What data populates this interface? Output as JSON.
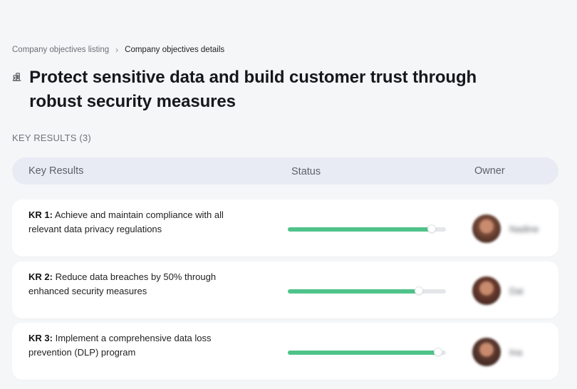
{
  "breadcrumb": {
    "parent": "Company objectives listing",
    "separator": "›",
    "current": "Company objectives details"
  },
  "objective": {
    "icon": "building-icon",
    "title": "Protect sensitive data and build customer trust through robust security measures"
  },
  "section": {
    "label": "KEY RESULTS (3)"
  },
  "table": {
    "headers": {
      "key_results": "Key Results",
      "status": "Status",
      "owner": "Owner"
    },
    "rows": [
      {
        "label": "KR 1:",
        "text": "Achieve and maintain compliance with all relevant data privacy regulations",
        "progress": 0.91,
        "owner": "Nadine",
        "avatar_color": "#7a4a38"
      },
      {
        "label": "KR 2:",
        "text": "Reduce data breaches by 50% through enhanced security measures",
        "progress": 0.83,
        "owner": "Dai",
        "avatar_color": "#6b3b2e"
      },
      {
        "label": "KR 3:",
        "text": "Implement a comprehensive data loss prevention (DLP) program",
        "progress": 0.95,
        "owner": "Ina",
        "avatar_color": "#5e3a30"
      }
    ]
  },
  "colors": {
    "progress_fill": "#4fc38a",
    "progress_track": "#e4e6ea",
    "header_bg": "#e8ebf3",
    "page_bg": "#f5f6f8"
  }
}
